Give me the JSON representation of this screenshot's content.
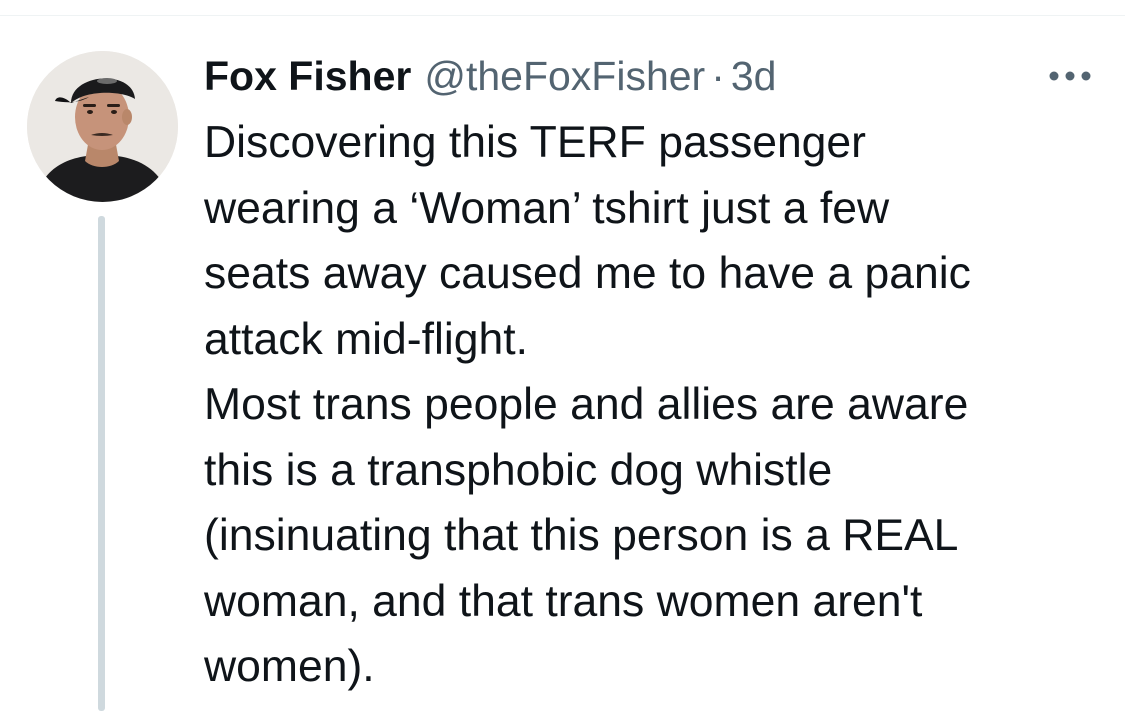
{
  "tweet": {
    "author": {
      "display_name": "Fox Fisher",
      "handle": "@theFoxFisher"
    },
    "separator": "·",
    "timestamp": "3d",
    "text_lines": [
      "Discovering this TERF passenger",
      "wearing a ‘Woman’ tshirt just a few",
      "seats away caused me to have a panic",
      "attack mid-flight.",
      "Most trans people and allies are aware",
      "this is a transphobic dog whistle",
      "(insinuating that this person is a REAL",
      "woman, and that trans women aren't",
      "women)."
    ],
    "icons": {
      "more": "more-horizontal-icon",
      "avatar": "avatar-photo"
    },
    "colors": {
      "text_primary": "#0f1419",
      "text_secondary": "#536471",
      "thread_line": "#cfd9de",
      "divider": "#eff3f4"
    }
  }
}
